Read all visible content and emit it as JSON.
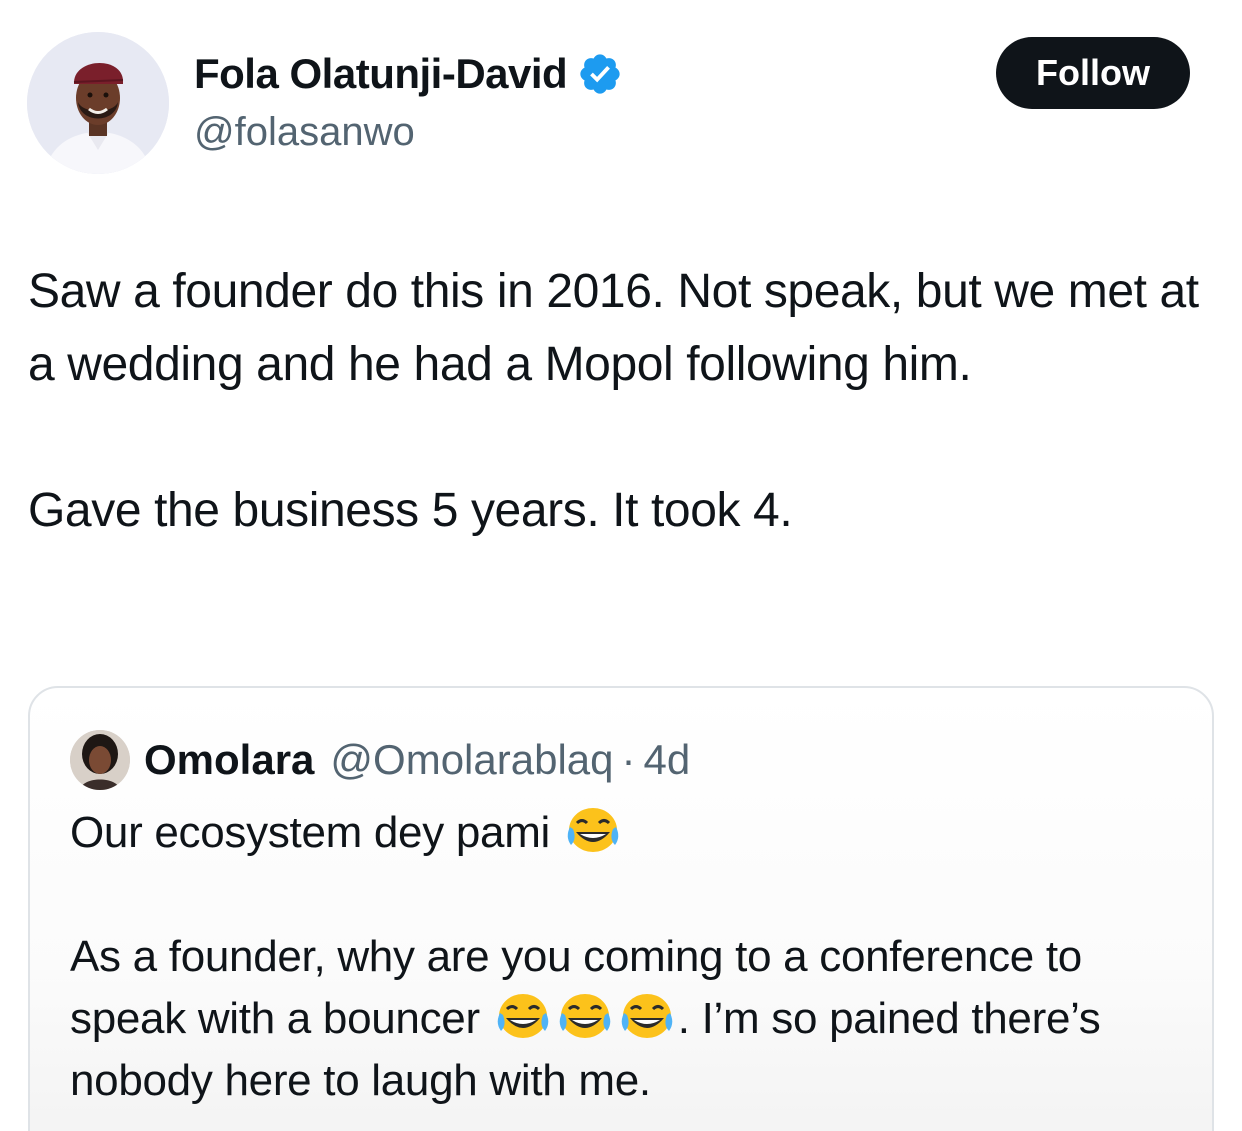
{
  "author": {
    "name": "Fola Olatunji-David",
    "handle": "@folasanwo",
    "verified": true,
    "verified_icon": "verified-badge-icon"
  },
  "follow_button": {
    "label": "Follow"
  },
  "tweet": {
    "paragraph1": "Saw a founder do this in 2016. Not speak, but we met at a wedding and he had a Mopol following him.",
    "paragraph2": "Gave the business 5 years. It took 4."
  },
  "quote": {
    "name": "Omolara",
    "handle": "@Omolarablaq",
    "separator": "·",
    "time": "4d",
    "line1": "Our ecosystem dey pami",
    "para2_a": "As a founder, why are you coming to a conference to speak with a bouncer",
    "para2_b": ". I’m so pained there’s nobody here to laugh with me.",
    "emoji_icon": "face-with-tears-of-joy-icon"
  },
  "colors": {
    "text": "#0f1419",
    "secondary": "#536471",
    "verified_blue": "#1d9bf0",
    "button_bg": "#0f1419",
    "card_border": "#dfe3e7"
  }
}
